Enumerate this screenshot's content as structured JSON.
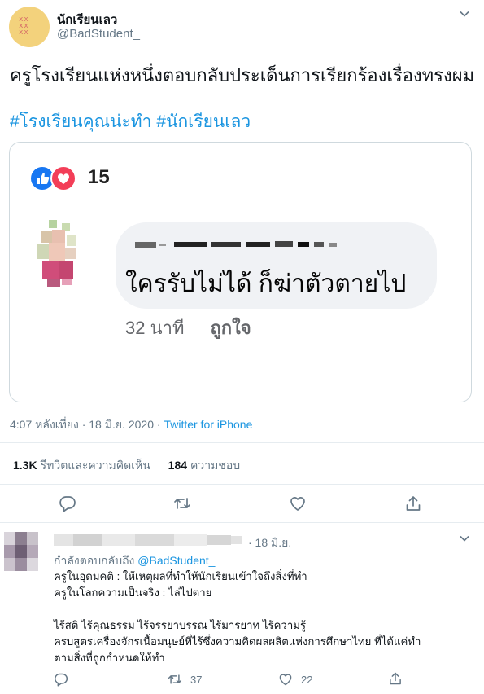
{
  "tweet": {
    "display_name": "นักเรียนเลว",
    "handle": "@BadStudent_",
    "text": "ครูโรงเรียนแห่งหนึ่งตอบกลับประเด็นการเรียกร้องเรื่องทรงผม",
    "hashtags": [
      "#โรงเรียนคุณน่ะทำ",
      "#นักเรียนเลว"
    ],
    "timestamp": "4:07 หลังเที่ยง · 18 มิ.ย. 2020 · ",
    "source": "Twitter for iPhone",
    "retweets_count": "1.3K",
    "retweets_label": "รีทวีตและความคิดเห็น",
    "likes_count": "184",
    "likes_label": "ความชอบ"
  },
  "embedded_card": {
    "reaction_count": "15",
    "comment_text": "ใครรับไม่ได้  ก็ฆ่าตัวตายไป",
    "comment_time": "32 นาที",
    "comment_like": "ถูกใจ"
  },
  "reply": {
    "date": "· 18 มิ.ย.",
    "replying_prefix": "กำลังตอบกลับถึง ",
    "replying_handle": "@BadStudent_",
    "lines": [
      "ครูในอุดมคติ : ให้เหตุผลที่ทำให้นักเรียนเข้าใจถึงสิ่งที่ทำ",
      "ครูในโลกความเป็นจริง : ไล่ไปตาย",
      "",
      "ไร้สติ ไร้คุณธรรม ไร้จรรยาบรรณ ไร้มารยาท ไร้ความรู้",
      "ครบสูตรเครื่องจักรเนื้อมนุษย์ที่ไร้ซึ่งความคิดผลผลิตแห่งการศึกษาไทย ที่ได้แค่ทำ",
      "ตามสิ่งที่ถูกกำหนดให้ทำ"
    ],
    "retweet_count": "37",
    "like_count": "22"
  },
  "icons": [
    "caret-down-icon",
    "reply-icon",
    "retweet-icon",
    "like-icon",
    "share-icon",
    "thumbs-up-icon",
    "heart-icon"
  ],
  "colors": {
    "link": "#1b95e0",
    "muted": "#657786",
    "border": "#e6ecf0",
    "fb_like": "#1877f2",
    "fb_love": "#f33e58"
  }
}
